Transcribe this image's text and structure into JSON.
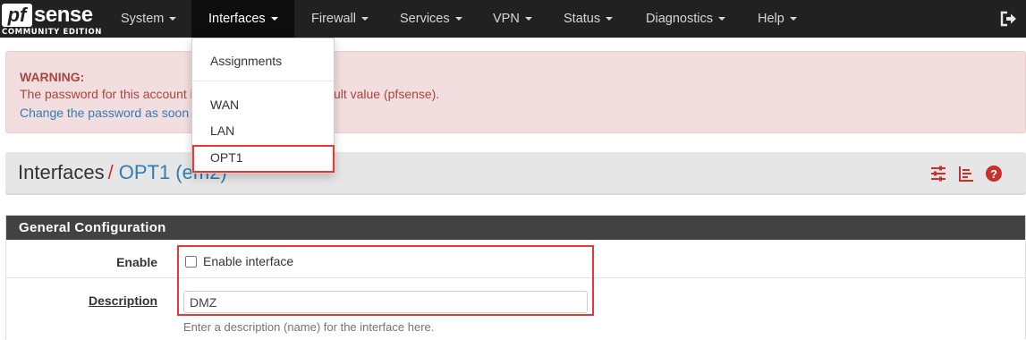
{
  "brand": {
    "logo_pf": "pf",
    "logo_sense": "sense",
    "edition": "COMMUNITY EDITION"
  },
  "nav": {
    "items": [
      {
        "label": "System"
      },
      {
        "label": "Interfaces"
      },
      {
        "label": "Firewall"
      },
      {
        "label": "Services"
      },
      {
        "label": "VPN"
      },
      {
        "label": "Status"
      },
      {
        "label": "Diagnostics"
      },
      {
        "label": "Help"
      }
    ],
    "active": "Interfaces",
    "logout_icon": "logout-icon"
  },
  "interfaces_menu": {
    "items": [
      {
        "label": "Assignments"
      },
      {
        "label": "WAN"
      },
      {
        "label": "LAN"
      },
      {
        "label": "OPT1"
      }
    ],
    "highlighted": "OPT1"
  },
  "warning": {
    "title": "WARNING:",
    "line1": "The password for this account is currently set to the default value (pfsense).",
    "line2": "Change the password as soon as possible."
  },
  "breadcrumb": {
    "section": "Interfaces",
    "separator": "/",
    "current": "OPT1 (em2)",
    "icons": [
      "settings-sliders-icon",
      "list-chart-icon",
      "help-icon"
    ]
  },
  "form": {
    "heading": "General Configuration",
    "enable": {
      "label": "Enable",
      "checkbox_label": "Enable interface",
      "checked": false
    },
    "description": {
      "label": "Description",
      "value": "DMZ",
      "help": "Enter a description (name) for the interface here."
    }
  },
  "colors": {
    "navbar": "#212121",
    "accent_red": "#e53935",
    "warning_bg": "#f2dede",
    "warning_text": "#a94442",
    "link": "#337ab7",
    "panel_heading": "#424242"
  }
}
